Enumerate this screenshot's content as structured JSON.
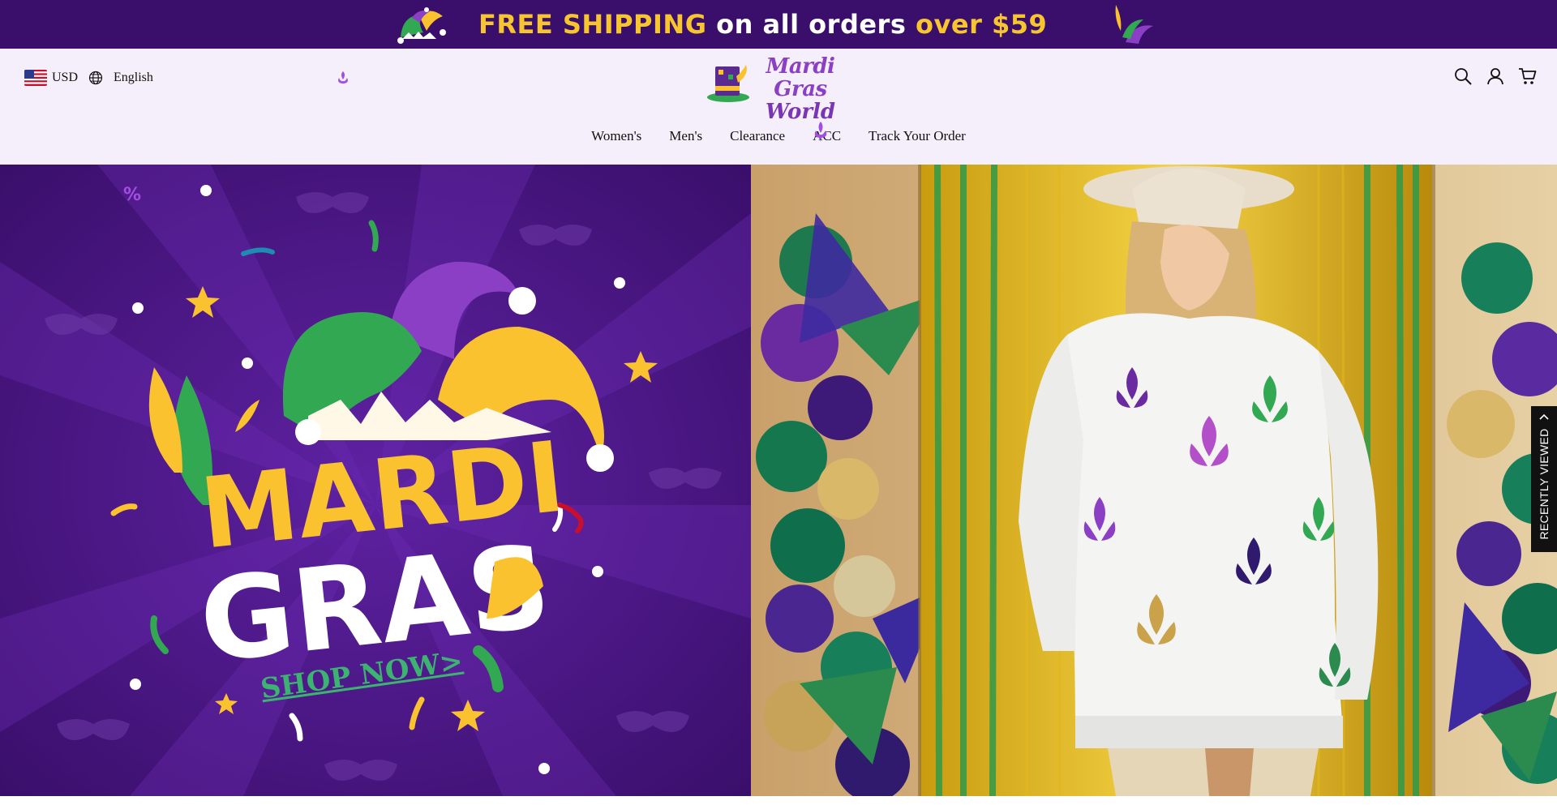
{
  "announcement": {
    "part1": "FREE SHIPPING",
    "part2": " on all orders ",
    "part3": "over $59",
    "colors": {
      "background": "#3a0f6b",
      "yellow": "#f7c62f",
      "white": "#ffffff"
    }
  },
  "header": {
    "currency": "USD",
    "language": "English",
    "logo": {
      "line1": "Mardi Gras",
      "line2": "World"
    },
    "icons": [
      "search-icon",
      "account-icon",
      "cart-icon"
    ],
    "background": "#f5effb"
  },
  "nav": {
    "items": [
      {
        "label": "Women's"
      },
      {
        "label": "Men's"
      },
      {
        "label": "Clearance"
      },
      {
        "label": "ACC"
      },
      {
        "label": "Track Your Order"
      }
    ]
  },
  "hero": {
    "banner_title_line1": "MARDI",
    "banner_title_line2": "GRAS",
    "cta": "SHOP NOW>",
    "colors": {
      "purple": "#45157d",
      "yellow": "#f9c22e",
      "green": "#33a852",
      "white": "#ffffff"
    }
  },
  "sidebar": {
    "recently_viewed": "RECENTLY VIEWED"
  }
}
